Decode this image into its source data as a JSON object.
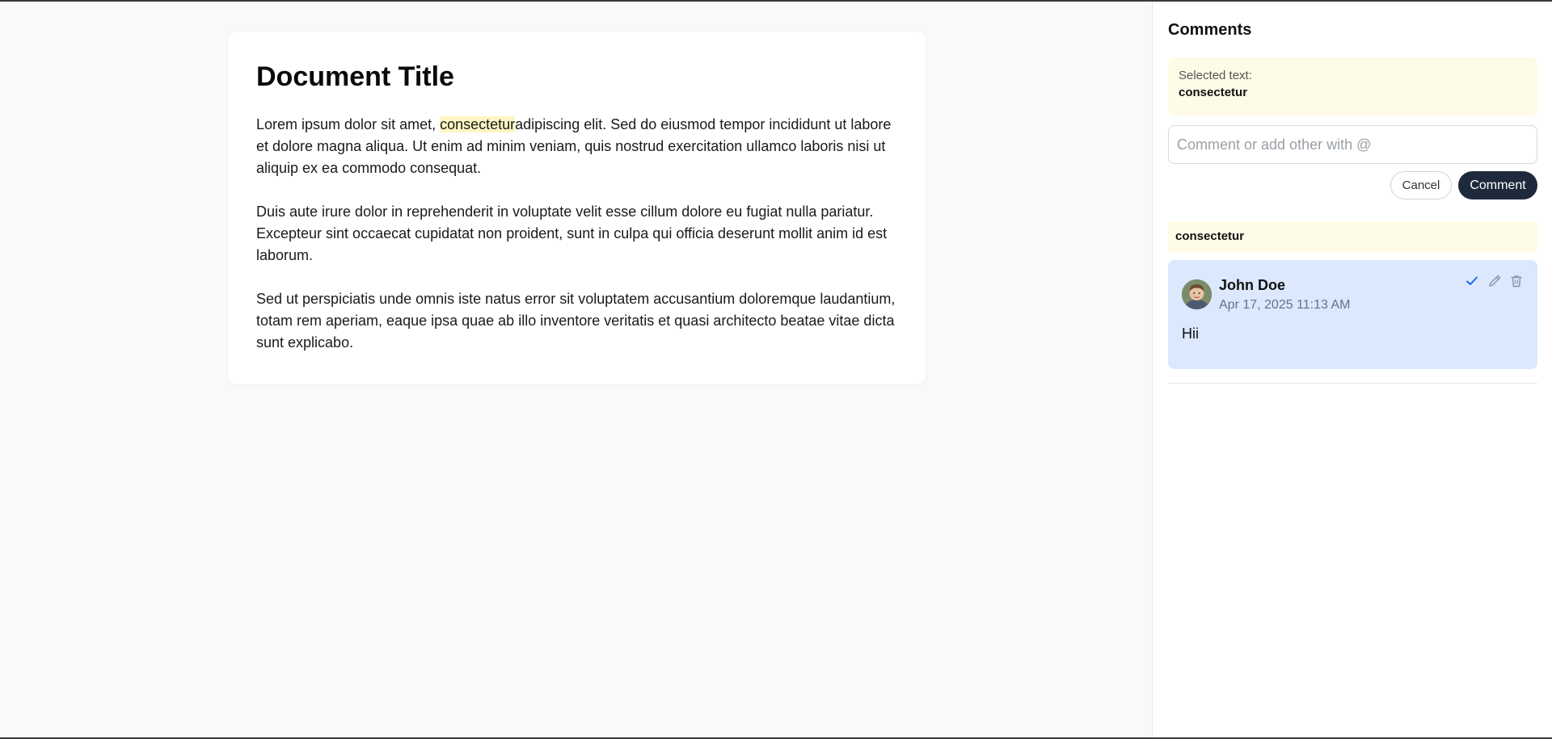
{
  "document": {
    "title": "Document Title",
    "paragraph1_before": "Lorem ipsum dolor sit amet, ",
    "paragraph1_highlight": "consectetur",
    "paragraph1_after": "adipiscing elit. Sed do eiusmod tempor incididunt ut labore et dolore magna aliqua. Ut enim ad minim veniam, quis nostrud exercitation ullamco laboris nisi ut aliquip ex ea commodo consequat.",
    "paragraph2": "Duis aute irure dolor in reprehenderit in voluptate velit esse cillum dolore eu fugiat nulla pariatur. Excepteur sint occaecat cupidatat non proident, sunt in culpa qui officia deserunt mollit anim id est laborum.",
    "paragraph3": "Sed ut perspiciatis unde omnis iste natus error sit voluptatem accusantium doloremque laudantium, totam rem aperiam, eaque ipsa quae ab illo inventore veritatis et quasi architecto beatae vitae dicta sunt explicabo."
  },
  "sidebar": {
    "title": "Comments",
    "selected_label": "Selected text:",
    "selected_value": "consectetur",
    "input_placeholder": "Comment or add other with @",
    "input_value": "",
    "cancel_label": "Cancel",
    "comment_label": "Comment",
    "thread": {
      "quote": "consectetur",
      "comments": [
        {
          "author": "John Doe",
          "timestamp": "Apr 17, 2025 11:13 AM",
          "body": "Hii",
          "icons": [
            "check-icon",
            "pencil-icon",
            "trash-icon"
          ]
        }
      ]
    }
  },
  "colors": {
    "highlight": "#fef6c2",
    "comment_card_bg": "#dbe8fd",
    "primary_button": "#1e293b",
    "resolve_icon": "#2563eb"
  }
}
